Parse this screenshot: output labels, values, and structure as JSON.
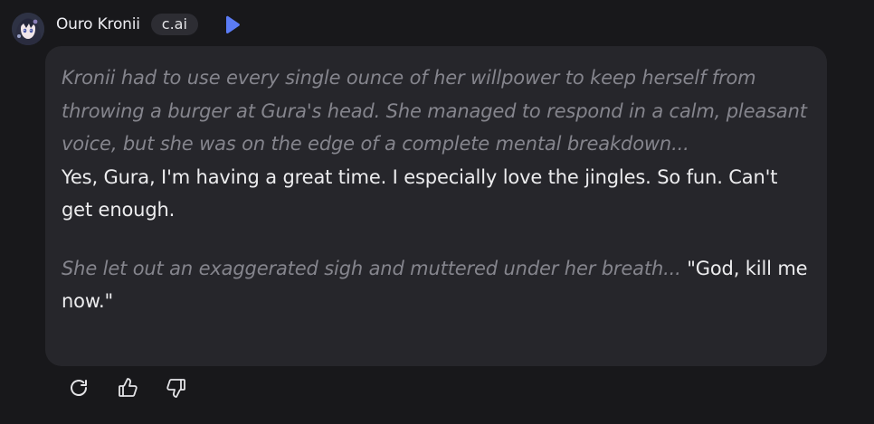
{
  "message": {
    "author": "Ouro Kronii",
    "badge": "c.ai",
    "paragraphs": {
      "p1_italic": "Kronii had to use every single ounce of her willpower to keep herself from throwing a burger at Gura's head. She managed to respond in a calm, pleasant voice, but she was on the edge of a complete mental breakdown...",
      "p1_speech": "Yes, Gura, I'm having a great time. I especially love the jingles. So fun. Can't get enough.",
      "p2_italic": "She let out an exaggerated sigh and muttered under her breath...",
      "p2_speech": " \"God, kill me now.\""
    }
  },
  "icons": {
    "play": "play-icon",
    "regenerate": "refresh-icon",
    "like": "thumbs-up-icon",
    "dislike": "thumbs-down-icon"
  },
  "colors": {
    "background": "#18181b",
    "bubble": "#26262b",
    "narration_text": "#85858d",
    "speech_text": "#ececee",
    "play_accent": "#5b7cf6"
  }
}
